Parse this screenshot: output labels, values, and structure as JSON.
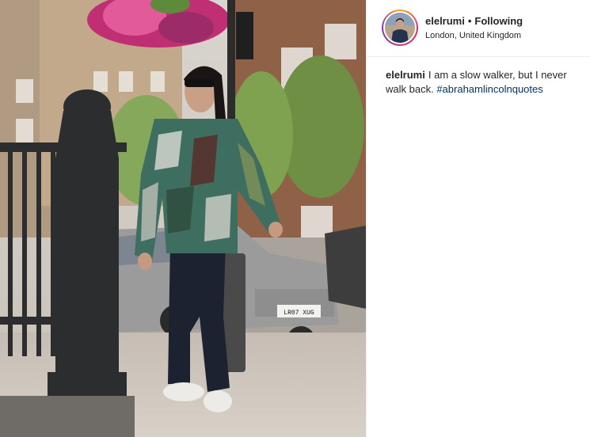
{
  "post": {
    "username": "elelrumi",
    "separator": "•",
    "follow_status": "Following",
    "location": "London, United Kingdom",
    "caption": {
      "username": "elelrumi",
      "text": "I am a slow walker, but I never walk back.",
      "hashtag": "#abrahamlincolnquotes"
    },
    "license_plate": "LR07 XUG"
  },
  "colors": {
    "text_primary": "#262626",
    "hashtag": "#003569",
    "divider": "#efefef"
  }
}
